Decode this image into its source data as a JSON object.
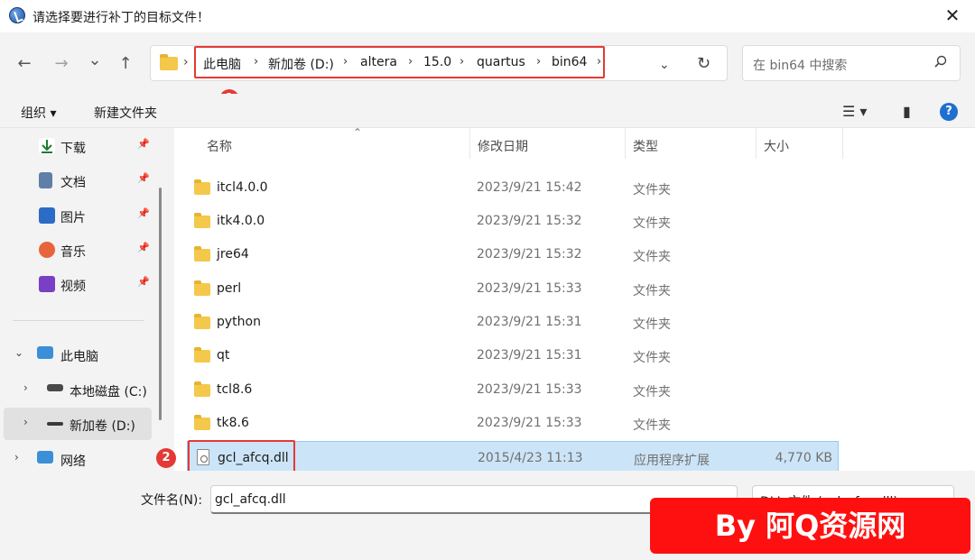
{
  "window": {
    "title": "请选择要进行补丁的目标文件！",
    "close_glyph": "✕"
  },
  "nav": {
    "back_glyph": "←",
    "forward_glyph": "→",
    "recent_glyph": "⌄",
    "up_glyph": "↑",
    "breadcrumb": [
      "此电脑",
      "新加卷 (D:)",
      "altera",
      "15.0",
      "quartus",
      "bin64"
    ],
    "dropdown_glyph": "⌄",
    "refresh_glyph": "↻",
    "search_placeholder": "在 bin64 中搜索"
  },
  "toolbar": {
    "organize_label": "组织 ▾",
    "new_folder_label": "新建文件夹",
    "view_glyph": "☰ ▾",
    "preview_glyph": "▮",
    "help_glyph": "?"
  },
  "sidebar": {
    "quick_items": [
      {
        "label": "下载",
        "icon": "download-icon",
        "color": "#1e7b34"
      },
      {
        "label": "文档",
        "icon": "document-icon",
        "color": "#5f7ea8"
      },
      {
        "label": "图片",
        "icon": "picture-icon",
        "color": "#2b6cc4"
      },
      {
        "label": "音乐",
        "icon": "music-icon",
        "color": "#e8643c"
      },
      {
        "label": "视频",
        "icon": "video-icon",
        "color": "#7a3fc4"
      }
    ],
    "tree_items": [
      {
        "label": "此电脑",
        "icon": "computer-icon"
      },
      {
        "label": "本地磁盘 (C:)",
        "icon": "drive-c-icon"
      },
      {
        "label": "新加卷 (D:)",
        "icon": "drive-d-icon"
      },
      {
        "label": "网络",
        "icon": "network-icon"
      }
    ]
  },
  "columns": [
    "名称",
    "修改日期",
    "类型",
    "大小"
  ],
  "rows": [
    {
      "name": "itcl4.0.0",
      "date": "2023/9/21 15:42",
      "type": "文件夹",
      "size": ""
    },
    {
      "name": "itk4.0.0",
      "date": "2023/9/21 15:32",
      "type": "文件夹",
      "size": ""
    },
    {
      "name": "jre64",
      "date": "2023/9/21 15:32",
      "type": "文件夹",
      "size": ""
    },
    {
      "name": "perl",
      "date": "2023/9/21 15:33",
      "type": "文件夹",
      "size": ""
    },
    {
      "name": "python",
      "date": "2023/9/21 15:31",
      "type": "文件夹",
      "size": ""
    },
    {
      "name": "qt",
      "date": "2023/9/21 15:31",
      "type": "文件夹",
      "size": ""
    },
    {
      "name": "tcl8.6",
      "date": "2023/9/21 15:33",
      "type": "文件夹",
      "size": ""
    },
    {
      "name": "tk8.6",
      "date": "2023/9/21 15:33",
      "type": "文件夹",
      "size": ""
    },
    {
      "name": "gcl_afcq.dll",
      "date": "2015/4/23 11:13",
      "type": "应用程序扩展",
      "size": "4,770 KB"
    }
  ],
  "bottom": {
    "filename_label": "文件名(N):",
    "filename_value": "gcl_afcq.dll",
    "filter_value": "DLL 文件 (gcl_afcq.dll)"
  },
  "badges": [
    "1",
    "2"
  ],
  "watermark": "By 阿Q资源网",
  "colors": {
    "accent_red": "#e53935",
    "selection": "#cce4f7"
  }
}
